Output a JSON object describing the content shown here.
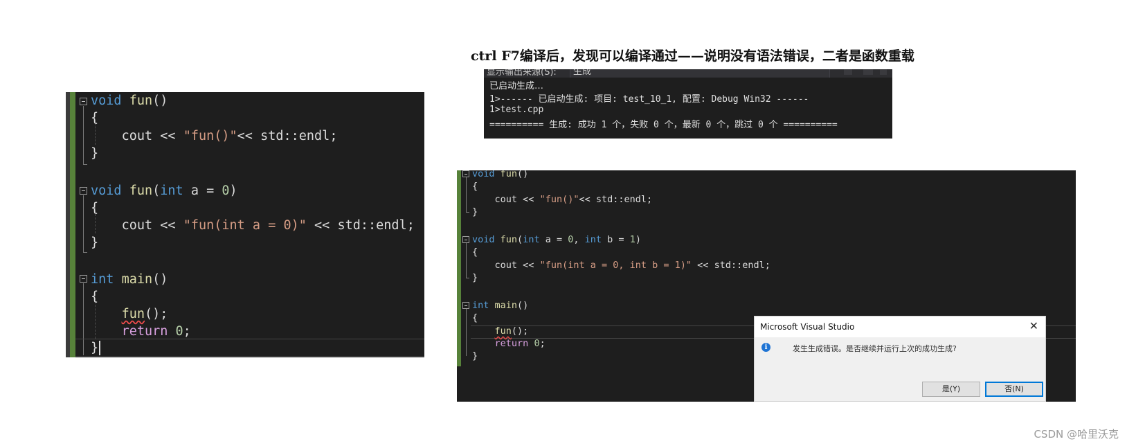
{
  "left_editor": {
    "l1": [
      "void",
      "fun",
      "()"
    ],
    "l2": "{",
    "l3": [
      "cout",
      "<<",
      "\"fun()\"",
      "<<",
      "std::endl;"
    ],
    "l4": "}",
    "l6": [
      "void",
      "fun",
      "(",
      "int",
      "a = ",
      "0",
      ")"
    ],
    "l7": "{",
    "l8": [
      "cout",
      "<<",
      "\"fun(int a = 0)\"",
      "<<",
      "std::endl;"
    ],
    "l9": "}",
    "l11": [
      "int",
      "main",
      "()"
    ],
    "l12": "{",
    "l13": [
      "fun",
      "();"
    ],
    "l14": [
      "return",
      "0",
      ";"
    ],
    "l15": "}"
  },
  "caption": "ctrl F7编译后，发现可以编译通过——说明没有语法错误，二者是函数重载",
  "output_panel": {
    "header_label": "显示输出来源(S):",
    "source_value": "生成",
    "lines": [
      "已启动生成…",
      "1>------ 已启动生成: 项目: test_10_1, 配置: Debug Win32 ------",
      "1>test.cpp",
      "========== 生成: 成功 1 个，失败 0 个，最新 0 个，跳过 0 个 =========="
    ]
  },
  "right_editor": {
    "l1": [
      "void",
      "fun",
      "()"
    ],
    "l2": "{",
    "l3": [
      "cout",
      "<<",
      "\"fun()\"",
      "<<",
      "std::endl;"
    ],
    "l4": "}",
    "l6": [
      "void",
      "fun",
      "(",
      "int",
      "a = ",
      "0",
      ", ",
      "int",
      "b = ",
      "1",
      ")"
    ],
    "l7": "{",
    "l8": [
      "cout",
      "<<",
      "\"fun(int a = 0, int b = 1)\"",
      "<<",
      "std::endl;"
    ],
    "l9": "}",
    "l11": [
      "int",
      "main",
      "()"
    ],
    "l12": "{",
    "l13": [
      "fun",
      "();"
    ],
    "l14": [
      "return",
      "0",
      ";"
    ],
    "l15": "}"
  },
  "dialog": {
    "title": "Microsoft Visual Studio",
    "close": "✕",
    "icon": "i",
    "message": "发生生成错误。是否继续并运行上次的成功生成?",
    "yes_label": "是(Y)",
    "no_label": "否(N)"
  },
  "watermark": "CSDN @哈里沃克"
}
